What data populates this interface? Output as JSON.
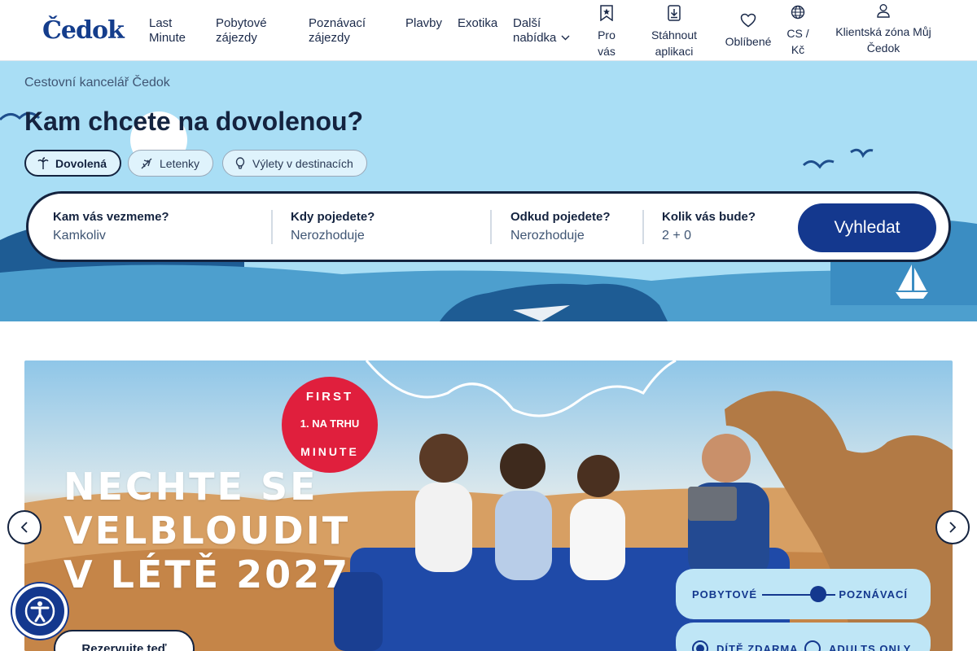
{
  "brand": {
    "logo_text": "Čedok",
    "color_primary": "#14388e",
    "color_dark": "#14233f",
    "hero_bg": "#a9def5"
  },
  "nav": {
    "items": [
      {
        "line1": "Last",
        "line2": "Minute"
      },
      {
        "line1": "Pobytové",
        "line2": "zájezdy"
      },
      {
        "line1": "Poznávací",
        "line2": "zájezdy"
      },
      {
        "line1": "Plavby",
        "line2": ""
      },
      {
        "line1": "Exotika",
        "line2": ""
      },
      {
        "line1": "Další",
        "line2": "nabídka"
      }
    ]
  },
  "utility": {
    "for_you": {
      "line1": "Pro",
      "line2": "vás",
      "icon": "bookmark-star-icon"
    },
    "download_app": {
      "line1": "Stáhnout",
      "line2": "aplikaci",
      "icon": "download-icon"
    },
    "favorites": {
      "label": "Oblíbené",
      "icon": "heart-icon"
    },
    "locale": {
      "line1": "CS /",
      "line2": "Kč",
      "icon": "globe-icon"
    },
    "client_zone": {
      "line1": "Klientská zóna Můj",
      "line2": "Čedok",
      "icon": "user-icon"
    }
  },
  "hero": {
    "breadcrumb": "Cestovní kancelář Čedok",
    "title": "Kam chcete na dovolenou?",
    "tabs": [
      {
        "label": "Dovolená",
        "icon": "palm-icon",
        "active": true
      },
      {
        "label": "Letenky",
        "icon": "plane-icon",
        "active": false
      },
      {
        "label": "Výlety v destinacích",
        "icon": "balloon-icon",
        "active": false
      }
    ],
    "search": {
      "where": {
        "label": "Kam vás vezmeme?",
        "value": "Kamkoliv"
      },
      "when": {
        "label": "Kdy pojedete?",
        "value": "Nerozhoduje"
      },
      "from": {
        "label": "Odkud pojedete?",
        "value": "Nerozhoduje"
      },
      "who": {
        "label": "Kolik vás bude?",
        "value": "2 + 0"
      },
      "button": "Vyhledat"
    }
  },
  "banner": {
    "headline": [
      "NECHTE SE",
      "VELBLOUDIT",
      "V LÉTĚ 2027"
    ],
    "badge": {
      "top": "FIRST",
      "middle": "1. NA TRHU",
      "bottom": "MINUTE"
    },
    "toggle": {
      "left": "POBYTOVÉ",
      "right": "POZNÁVACÍ"
    },
    "radios": [
      {
        "label": "DÍTĚ ZDARMA",
        "selected": true
      },
      {
        "label": "ADULTS ONLY",
        "selected": false
      }
    ],
    "cta": "Rezervujte teď"
  }
}
